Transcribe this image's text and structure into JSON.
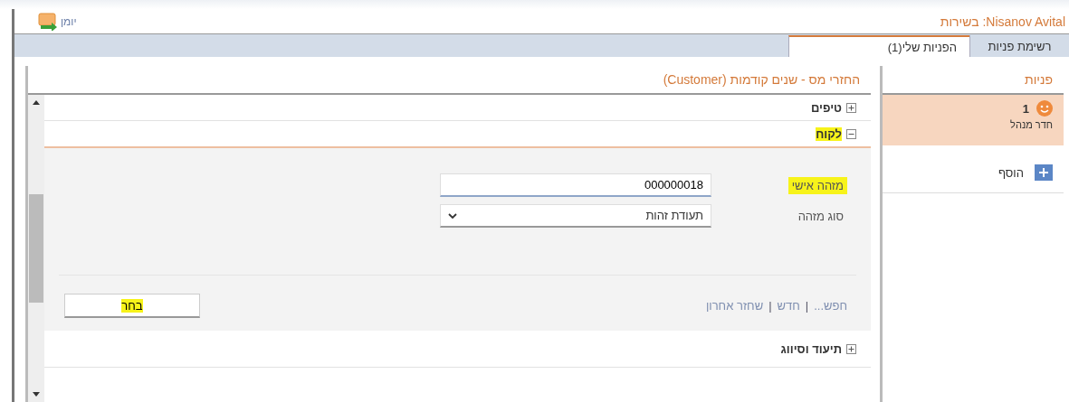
{
  "header": {
    "user_status": "Nisanov Avital: בשירות",
    "journal_label": "יומן"
  },
  "tabs": [
    {
      "label": "רשימת פניות",
      "selected": false
    },
    {
      "label": "הפניות שלי(1)",
      "selected": true
    }
  ],
  "side_panel": {
    "title": "פניות",
    "items": [
      {
        "count": "1",
        "name": "חדר מנהל",
        "selected": true
      }
    ],
    "add_label": "הוסף"
  },
  "main_panel": {
    "title": "החזרי מס - שנים קודמות (Customer)",
    "sections": [
      {
        "label": "טיפים",
        "expanded": false,
        "highlighted": false
      },
      {
        "label": "לקוח",
        "expanded": true,
        "highlighted": true,
        "form": {
          "fields": [
            {
              "kind": "text",
              "label": "מזהה אישי",
              "value": "000000018",
              "highlighted": true
            },
            {
              "kind": "select",
              "label": "סוג מזהה",
              "value": "תעודת זהות",
              "highlighted": false
            }
          ],
          "links": [
            "חפש...",
            "חדש",
            "שחזר אחרון"
          ],
          "link_separator": "|",
          "button": {
            "label": "בחר",
            "highlighted": true
          }
        }
      },
      {
        "label": "תיעוד וסיווג",
        "expanded": false,
        "highlighted": false
      }
    ]
  }
}
